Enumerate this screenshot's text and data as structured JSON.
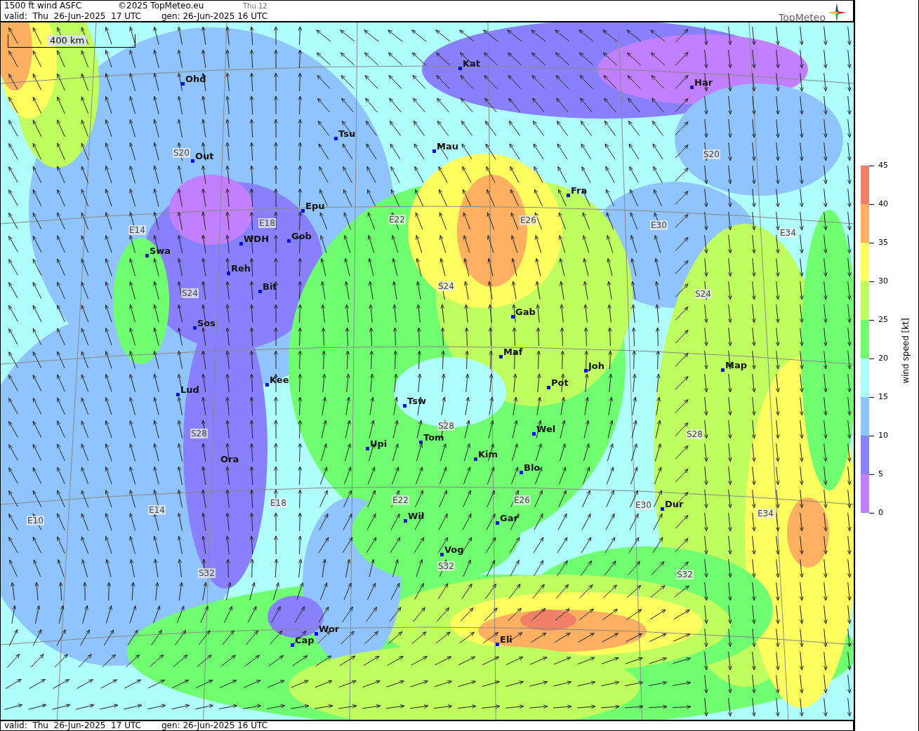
{
  "header": {
    "title": "1500 ft wind ASFC",
    "copyright": "©2025 TopMeteo.eu",
    "run_label": "Thu 12",
    "valid": "valid:  Thu  26-Jun-2025  17 UTC",
    "generated": "gen: 26-Jun-2025 16 UTC",
    "logo": "TopMeteo"
  },
  "map": {
    "scale_bar": "400 km",
    "cities": [
      {
        "name": "Ohd"
      },
      {
        "name": "Kat"
      },
      {
        "name": "Har"
      },
      {
        "name": "Tsu"
      },
      {
        "name": "Mau"
      },
      {
        "name": "Out"
      },
      {
        "name": "Fra"
      },
      {
        "name": "Epu"
      },
      {
        "name": "WDH"
      },
      {
        "name": "Gob"
      },
      {
        "name": "Swa"
      },
      {
        "name": "Reh"
      },
      {
        "name": "Bit"
      },
      {
        "name": "Gab"
      },
      {
        "name": "Sos"
      },
      {
        "name": "Maf"
      },
      {
        "name": "Joh"
      },
      {
        "name": "Map"
      },
      {
        "name": "Pot"
      },
      {
        "name": "Kee"
      },
      {
        "name": "Lud"
      },
      {
        "name": "Tsw"
      },
      {
        "name": "Wel"
      },
      {
        "name": "Upi"
      },
      {
        "name": "Tom"
      },
      {
        "name": "Kim"
      },
      {
        "name": "Blo"
      },
      {
        "name": "Ora"
      },
      {
        "name": "Dur"
      },
      {
        "name": "Wil"
      },
      {
        "name": "Gar"
      },
      {
        "name": "Vog"
      },
      {
        "name": "Wor"
      },
      {
        "name": "Cap"
      },
      {
        "name": "Eli"
      }
    ],
    "grid_labels": [
      "S20",
      "S20",
      "E14",
      "E18",
      "E22",
      "E26",
      "E30",
      "E34",
      "S24",
      "S24",
      "S24",
      "S28",
      "S28",
      "S28",
      "E10",
      "E14",
      "E18",
      "E22",
      "E26",
      "E30",
      "E34",
      "S32",
      "S32",
      "S32"
    ]
  },
  "scale": {
    "title": "wind speed [kt]",
    "ticks": [
      "45",
      "40",
      "35",
      "30",
      "25",
      "20",
      "15",
      "10",
      "5",
      "0"
    ],
    "bands": [
      {
        "color": "#f08068"
      },
      {
        "color": "#ffb060"
      },
      {
        "color": "#ffff60"
      },
      {
        "color": "#c0ff60"
      },
      {
        "color": "#70ff70"
      },
      {
        "color": "#b0ffff"
      },
      {
        "color": "#90c4ff"
      },
      {
        "color": "#8880ff"
      },
      {
        "color": "#c080ff"
      }
    ]
  },
  "footer": {
    "valid": "valid:  Thu  26-Jun-2025  17 UTC",
    "generated": "gen: 26-Jun-2025 16 UTC"
  }
}
